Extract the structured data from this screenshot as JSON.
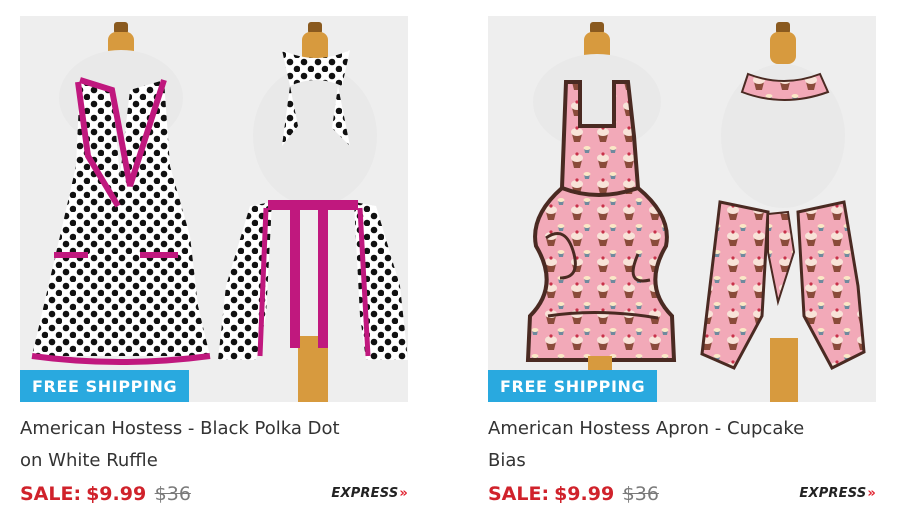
{
  "products": [
    {
      "badge": "FREE SHIPPING",
      "title_line1": "American Hostess - Black Polka Dot",
      "title_line2": "on White Ruffle",
      "sale_label": "SALE:",
      "sale_price": "$9.99",
      "original_price": "$36",
      "shipping_brand": "EXPRESS",
      "shipping_chevron": "»",
      "image_icon": "polka-dot-apron-image",
      "colors": {
        "fabric": "#ffffff",
        "dot": "#111111",
        "trim": "#c0187e"
      }
    },
    {
      "badge": "FREE SHIPPING",
      "title_line1": "American Hostess Apron - Cupcake",
      "title_line2": "Bias",
      "sale_label": "SALE:",
      "sale_price": "$9.99",
      "original_price": "$36",
      "shipping_brand": "EXPRESS",
      "shipping_chevron": "»",
      "image_icon": "cupcake-apron-image",
      "colors": {
        "fabric": "#f2a9b8",
        "trim": "#4a2a22",
        "cupcake": "#8a4b3a"
      }
    }
  ],
  "colors": {
    "badge_bg": "#29a9df",
    "sale_red": "#d0222b",
    "express_chevron": "#e0222f"
  }
}
